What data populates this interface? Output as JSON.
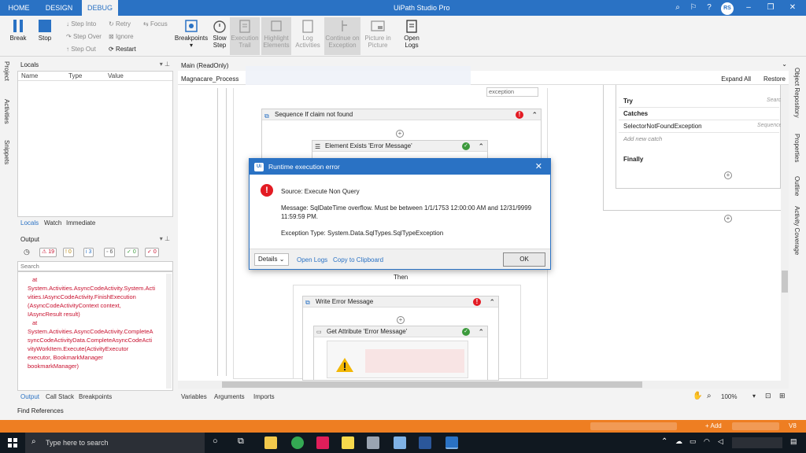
{
  "topbar": {
    "tabs": [
      "HOME",
      "DESIGN",
      "DEBUG"
    ],
    "title": "UiPath Studio Pro",
    "avatar": "RS"
  },
  "ribbon": {
    "break": "Break",
    "stop": "Stop",
    "step_into": "Step Into",
    "step_over": "Step Over",
    "step_out": "Step Out",
    "retry": "Retry",
    "ignore": "Ignore",
    "restart": "Restart",
    "focus": "Focus",
    "breakpoints": "Breakpoints",
    "slow_step_1": "Slow",
    "slow_step_2": "Step",
    "exec_trail_1": "Execution",
    "exec_trail_2": "Trail",
    "highlight_1": "Highlight",
    "highlight_2": "Elements",
    "log_act_1": "Log",
    "log_act_2": "Activities",
    "continue_1": "Continue on",
    "continue_2": "Exception",
    "pip_1": "Picture in",
    "pip_2": "Picture",
    "open_logs_1": "Open",
    "open_logs_2": "Logs"
  },
  "left_tabs": [
    "Project",
    "Activities",
    "Snippets"
  ],
  "locals": {
    "title": "Locals",
    "columns": [
      "Name",
      "Type",
      "Value"
    ],
    "bottom_tabs": [
      "Locals",
      "Watch",
      "Immediate"
    ]
  },
  "output": {
    "title": "Output",
    "counts": [
      "19",
      "0",
      "3",
      "6",
      "0",
      "0"
    ],
    "search_placeholder": "Search",
    "lines": [
      "at",
      "System.Activities.AsyncCodeActivity.System.Acti",
      "vities.IAsyncCodeActivity.FinishExecution",
      "(AsyncCodeActivityContext context,",
      "IAsyncResult result)",
      "at",
      "System.Activities.AsyncCodeActivity.CompleteA",
      "syncCodeActivityData.CompleteAsyncCodeActi",
      "vityWorkItem.Execute(ActivityExecutor",
      "executor, BookmarkManager",
      "bookmarkManager)"
    ],
    "bottom_tabs": [
      "Output",
      "Call Stack",
      "Breakpoints"
    ]
  },
  "find_references": "Find References",
  "designer": {
    "doc_tab": "Main (ReadOnly)",
    "breadcrumb": "Magnacare_Process",
    "expand_all": "Expand All",
    "restore": "Restore",
    "exception_field": "exception",
    "sequence": "Sequence If claim not found",
    "element_exists": "Element Exists 'Error Message'",
    "then_label": "Then",
    "write_error": "Write Error Message",
    "get_attribute": "Get Attribute 'Error Message'",
    "try_label": "Try",
    "try_search": "Search",
    "catches": "Catches",
    "catch_item": "SelectorNotFoundException",
    "catch_seq": "Sequence",
    "add_catch": "Add new catch",
    "finally": "Finally",
    "bottom_tabs": [
      "Variables",
      "Arguments",
      "Imports"
    ],
    "zoom": "100%"
  },
  "right_tabs": [
    "Object Repository",
    "Properties",
    "Outline",
    "Activity Coverage"
  ],
  "dialog": {
    "title": "Runtime execution error",
    "source": "Source: Execute Non Query",
    "message": "Message: SqlDateTime overflow. Must be between 1/1/1753 12:00:00 AM and 12/31/9999 11:59:59 PM.",
    "exception": "Exception Type: System.Data.SqlTypes.SqlTypeException",
    "details": "Details",
    "open_logs": "Open Logs",
    "copy": "Copy to Clipboard",
    "ok": "OK"
  },
  "statusbar": {
    "add": "+ Add",
    "version": "V8"
  },
  "taskbar": {
    "search_placeholder": "Type here to search"
  },
  "colors": {
    "accent": "#2a72c4",
    "status": "#ee7e22",
    "error": "#e31b23"
  }
}
